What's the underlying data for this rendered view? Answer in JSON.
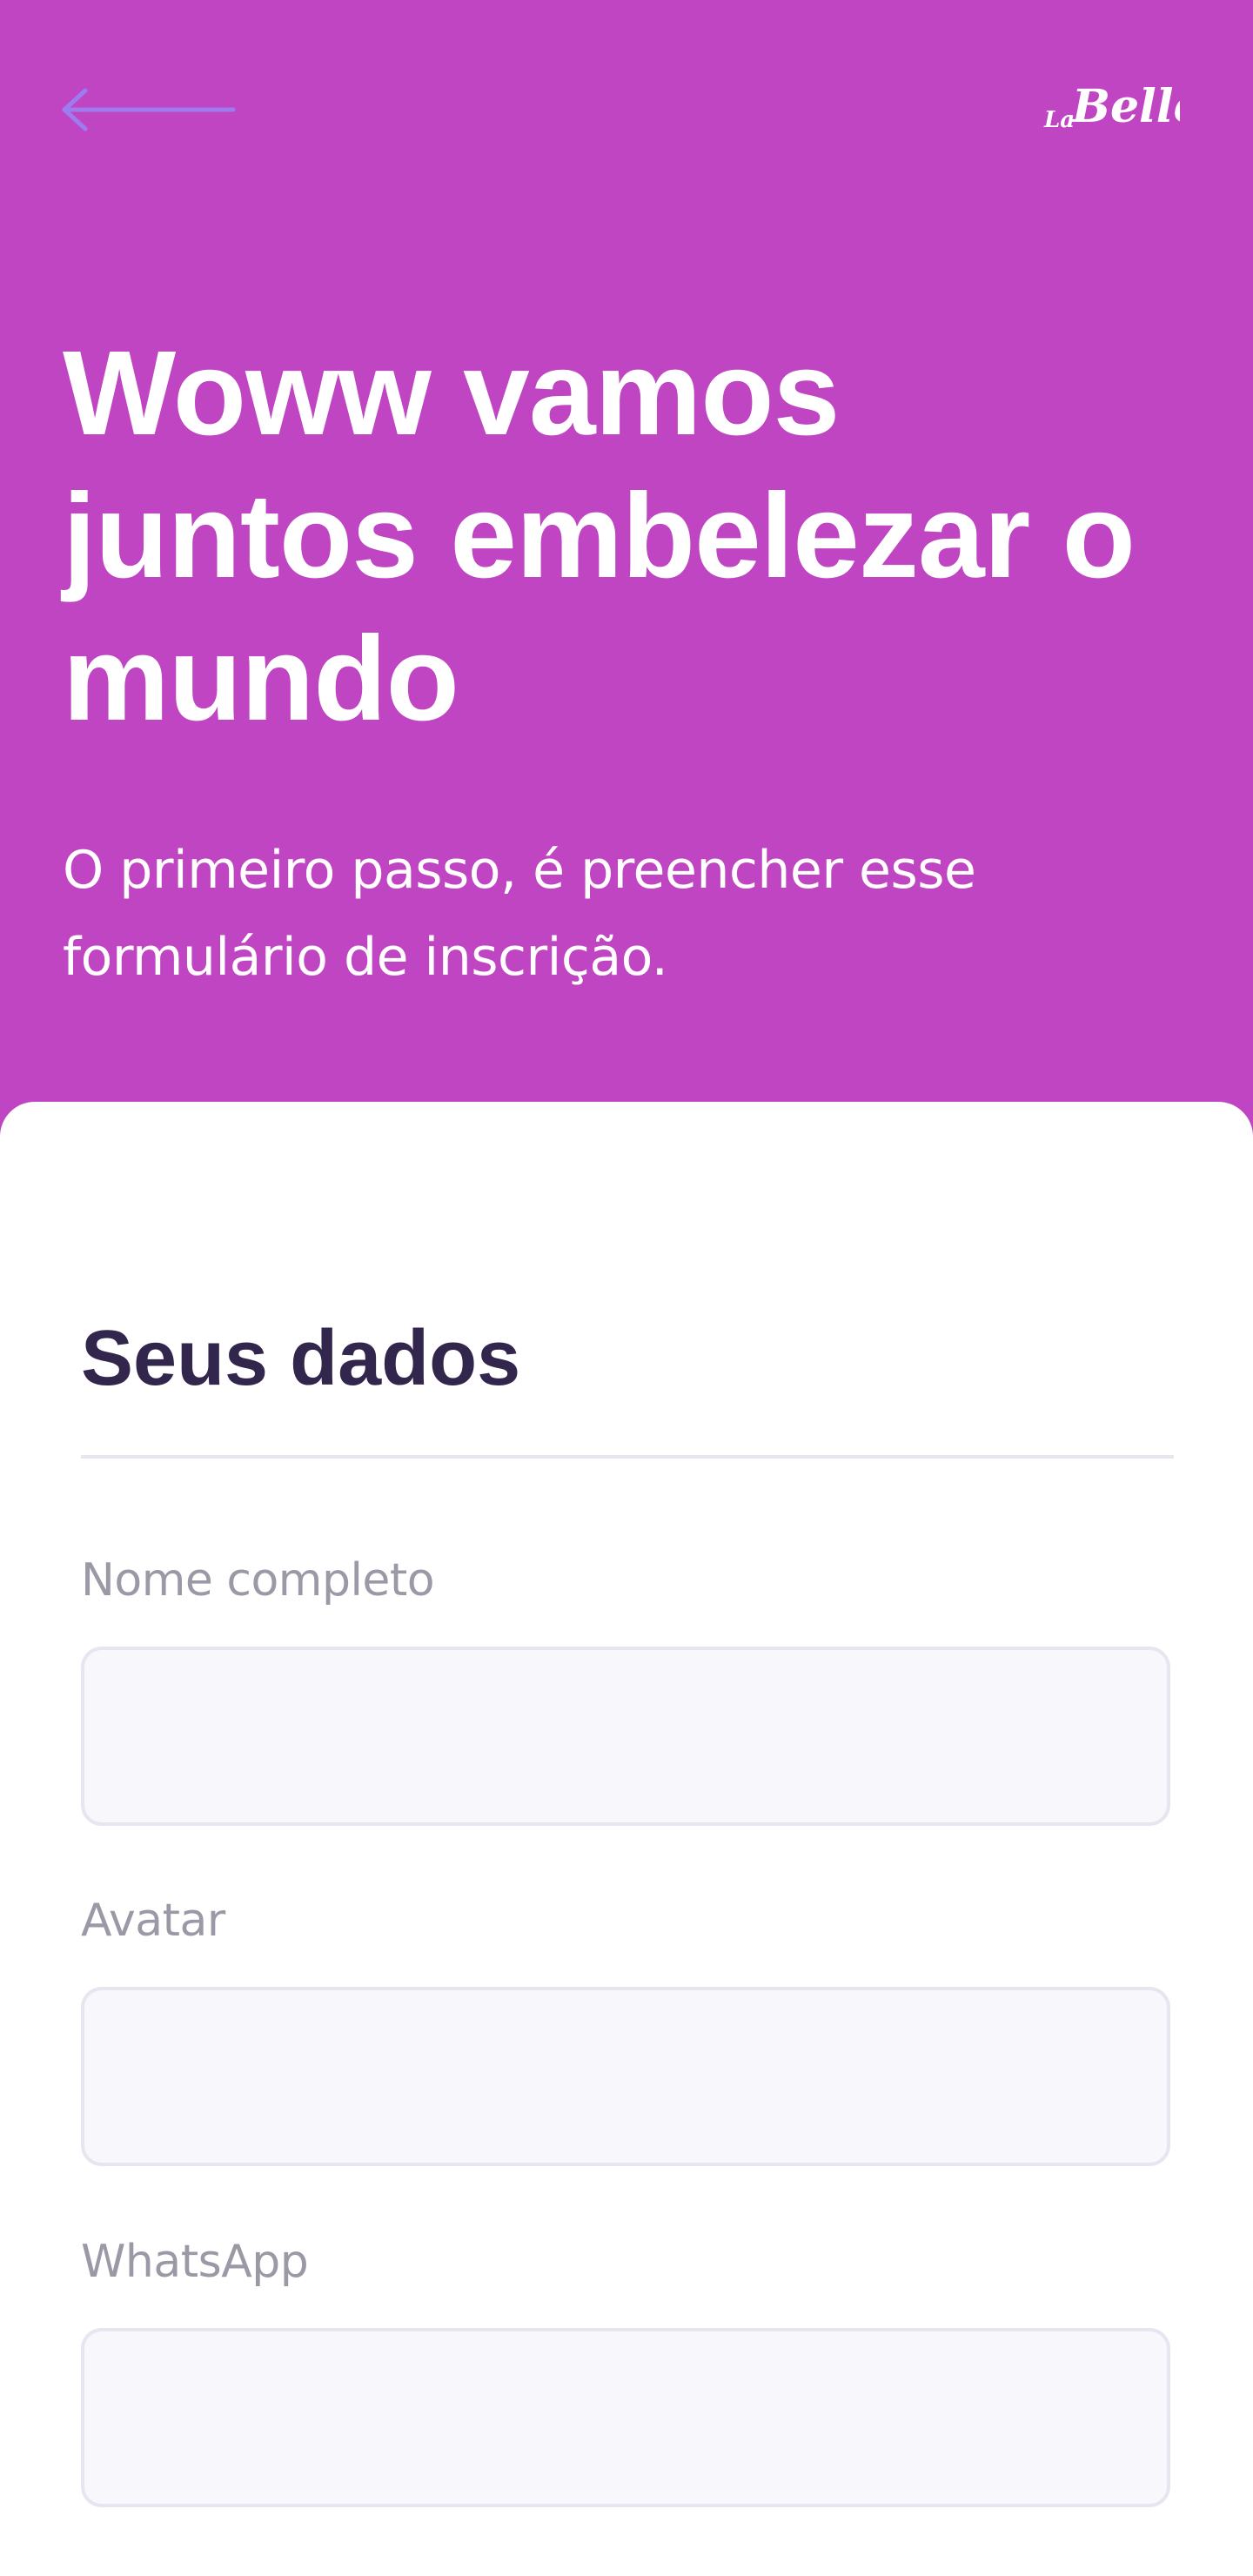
{
  "header": {
    "back_icon": "arrow-left-icon",
    "logo_text": "LaBelle",
    "title": "Woww vamos juntos embelezar o mundo",
    "subtitle": "O primeiro passo, é preencher esse formulário de inscrição.",
    "background_color": "#c045c2",
    "back_arrow_color": "#9d7cf0"
  },
  "form": {
    "section_title": "Seus dados",
    "fields": [
      {
        "label": "Nome completo",
        "value": "",
        "placeholder": ""
      },
      {
        "label": "Avatar",
        "value": "",
        "placeholder": ""
      },
      {
        "label": "WhatsApp",
        "value": "",
        "placeholder": ""
      }
    ],
    "title_color": "#32264d",
    "label_color": "#9c98a6",
    "input_background": "#f8f8fc",
    "input_border": "#e6e6f0"
  }
}
